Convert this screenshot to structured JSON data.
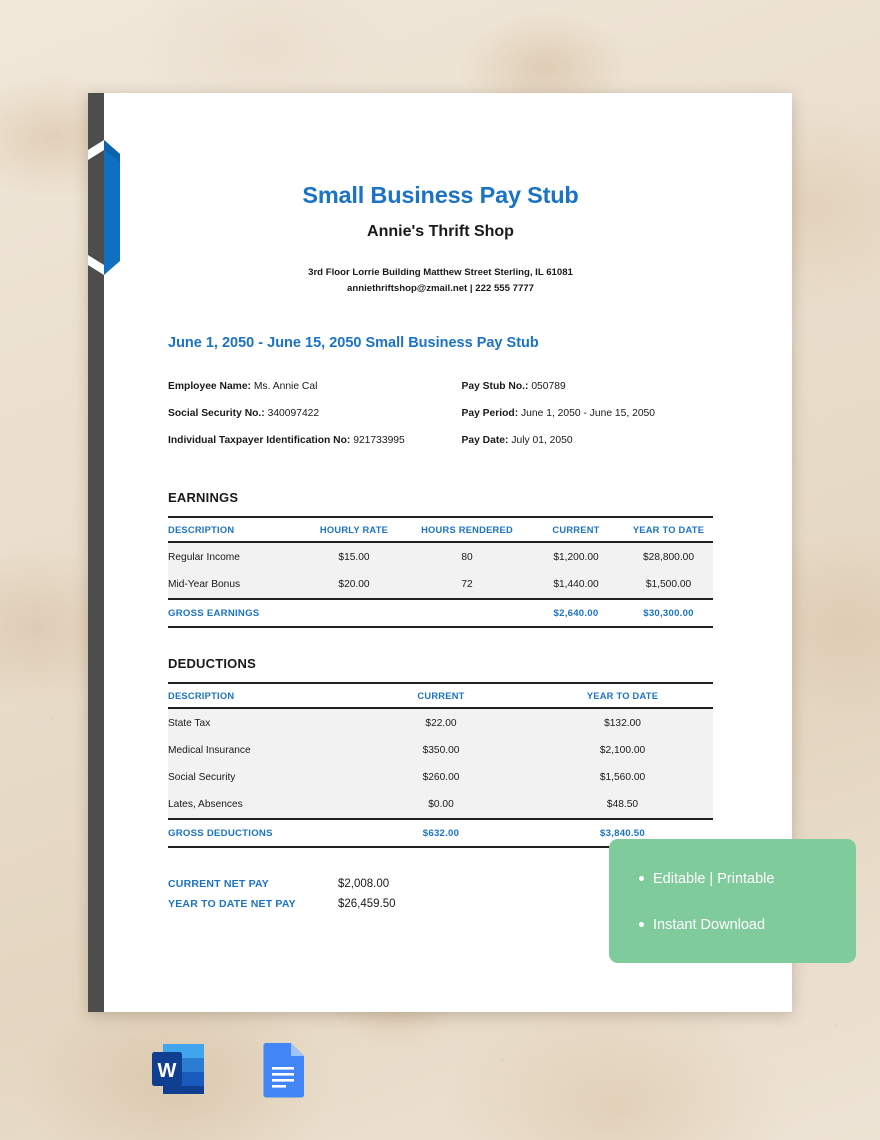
{
  "document": {
    "title": "Small Business Pay Stub",
    "company": "Annie's Thrift Shop",
    "address": "3rd Floor Lorrie Building Matthew Street Sterling, IL 61081",
    "contact": "anniethriftshop@zmail.net | 222 555 7777",
    "period_heading": "June 1, 2050 - June 15, 2050 Small Business Pay Stub"
  },
  "meta": {
    "left": [
      {
        "label": "Employee Name:",
        "value": "Ms. Annie Cal"
      },
      {
        "label": "Social Security No.:",
        "value": "340097422"
      },
      {
        "label": "Individual Taxpayer Identification No:",
        "value": "921733995"
      }
    ],
    "right": [
      {
        "label": "Pay Stub No.:",
        "value": "050789"
      },
      {
        "label": "Pay Period:",
        "value": "June 1, 2050 - June 15, 2050"
      },
      {
        "label": "Pay Date:",
        "value": "July 01, 2050"
      }
    ]
  },
  "earnings": {
    "section_title": "EARNINGS",
    "columns": [
      "DESCRIPTION",
      "HOURLY RATE",
      "HOURS RENDERED",
      "CURRENT",
      "YEAR TO DATE"
    ],
    "rows": [
      [
        "Regular Income",
        "$15.00",
        "80",
        "$1,200.00",
        "$28,800.00"
      ],
      [
        "Mid-Year Bonus",
        "$20.00",
        "72",
        "$1,440.00",
        "$1,500.00"
      ]
    ],
    "total": [
      "GROSS EARNINGS",
      "",
      "",
      "$2,640.00",
      "$30,300.00"
    ]
  },
  "deductions": {
    "section_title": "DEDUCTIONS",
    "columns": [
      "DESCRIPTION",
      "CURRENT",
      "YEAR TO DATE"
    ],
    "rows": [
      [
        "State Tax",
        "$22.00",
        "$132.00"
      ],
      [
        "Medical Insurance",
        "$350.00",
        "$2,100.00"
      ],
      [
        "Social Security",
        "$260.00",
        "$1,560.00"
      ],
      [
        "Lates, Absences",
        "$0.00",
        "$48.50"
      ]
    ],
    "total": [
      "GROSS DEDUCTIONS",
      "$632.00",
      "$3,840.50"
    ]
  },
  "netpay": [
    {
      "label": "CURRENT NET PAY",
      "value": "$2,008.00"
    },
    {
      "label": "YEAR TO DATE NET PAY",
      "value": "$26,459.50"
    }
  ],
  "promo": {
    "items": [
      "Editable | Printable",
      "Instant Download"
    ]
  },
  "formats": [
    {
      "name": "microsoft-word-icon",
      "label": "W"
    },
    {
      "name": "google-docs-icon",
      "label": ""
    }
  ],
  "colors": {
    "accent_blue": "#1b73c5",
    "spine_gray": "#4d4d4d",
    "promo_green": "#7fcb9b",
    "row_gray": "#f2f2f2",
    "rule_black": "#231f20"
  }
}
